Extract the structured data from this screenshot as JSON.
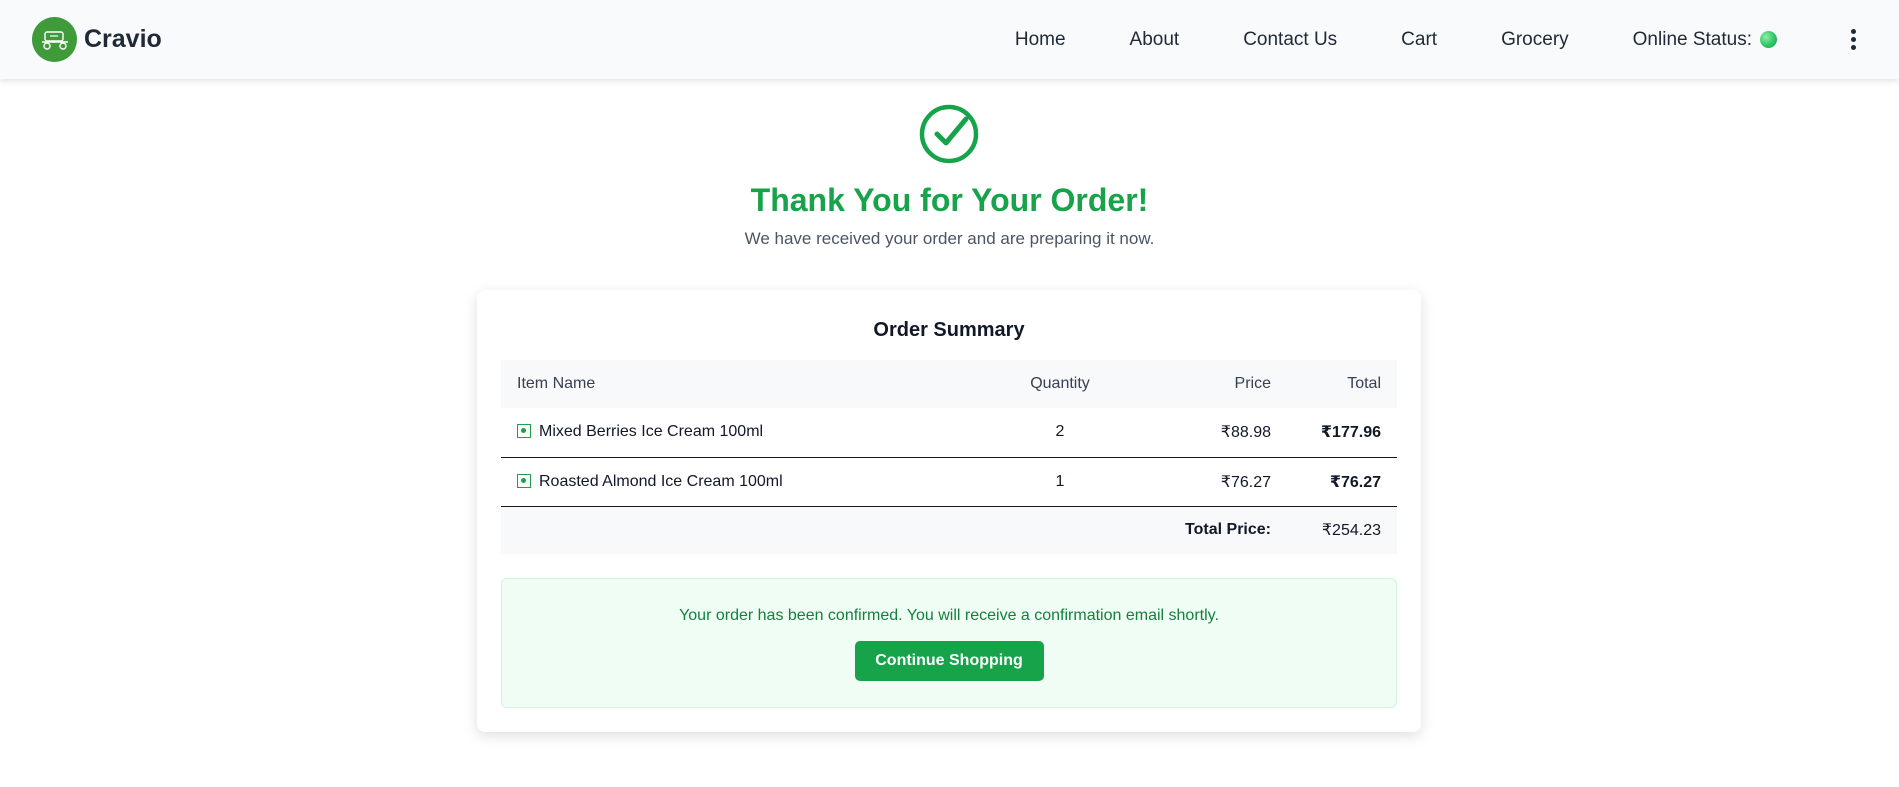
{
  "navbar": {
    "brand": "Cravio",
    "links": [
      "Home",
      "About",
      "Contact Us",
      "Cart",
      "Grocery"
    ],
    "status_label": "Online Status:",
    "status_color": "#2fc467"
  },
  "hero": {
    "icon": "check-circle-icon",
    "title": "Thank You for Your Order!",
    "subtitle": "We have received your order and are preparing it now."
  },
  "summary": {
    "title": "Order Summary",
    "columns": [
      "Item Name",
      "Quantity",
      "Price",
      "Total"
    ],
    "items": [
      {
        "name": "Mixed Berries Ice Cream 100ml",
        "quantity": "2",
        "price": "₹88.98",
        "total": "₹177.96"
      },
      {
        "name": "Roasted Almond Ice Cream 100ml",
        "quantity": "1",
        "price": "₹76.27",
        "total": "₹76.27"
      }
    ],
    "total_label": "Total Price:",
    "total_value": "₹254.23"
  },
  "confirmation": {
    "message": "Your order has been confirmed. You will receive a confirmation email shortly.",
    "button_label": "Continue Shopping"
  },
  "colors": {
    "accent": "#16a34a",
    "confirm_bg": "#f0fdf4",
    "confirm_text": "#15803d"
  }
}
